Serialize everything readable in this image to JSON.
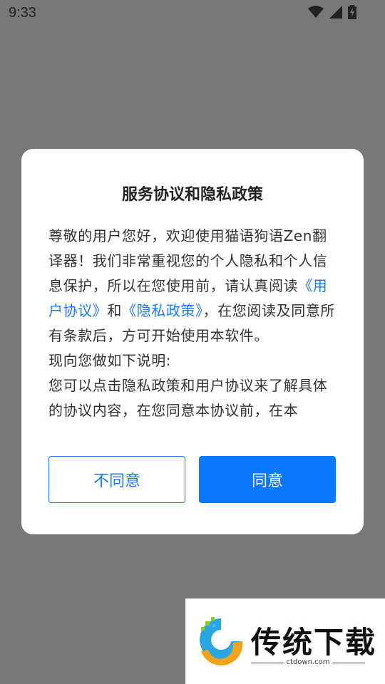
{
  "status_bar": {
    "time": "9:33"
  },
  "dialog": {
    "title": "服务协议和隐私政策",
    "body": {
      "part1": "尊敬的用户您好，欢迎使用猫语狗语Zen翻译器！我们非常重视您的个人隐私和个人信息保护，所以在您使用前，请认真阅读",
      "link_user_agreement": "《用户协议》",
      "and": "和",
      "link_privacy_policy": "《隐私政策》",
      "part2": "，在您阅读及同意所有条款后，方可开始使用本软件。",
      "para2": "现向您做如下说明:",
      "para3": "您可以点击隐私政策和用户协议来了解具体的协议内容，在您同意本协议前，在本"
    },
    "disagree_label": "不同意",
    "agree_label": "同意"
  },
  "watermark": {
    "title": "传统下载",
    "subtitle": "ctdown.com"
  },
  "colors": {
    "accent": "#0a78fa",
    "link": "#1e78f0",
    "overlay": "#787878"
  },
  "icons": [
    "wifi-icon",
    "signal-icon",
    "battery-charging-icon"
  ]
}
